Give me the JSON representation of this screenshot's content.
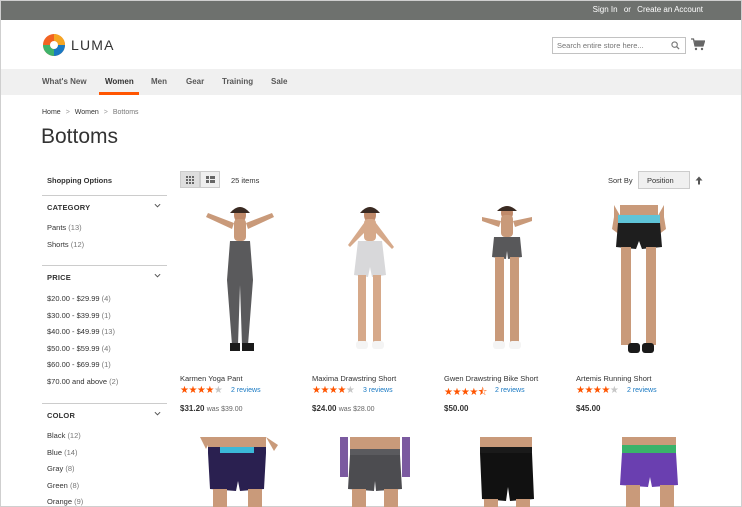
{
  "topbar": {
    "sign_in": "Sign In",
    "or": "or",
    "create_account": "Create an Account"
  },
  "header": {
    "logo_text": "LUMA",
    "search_placeholder": "Search entire store here..."
  },
  "nav": {
    "items": [
      "What's New",
      "Women",
      "Men",
      "Gear",
      "Training",
      "Sale"
    ],
    "active": "Women"
  },
  "breadcrumb": [
    "Home",
    "Women",
    "Bottoms"
  ],
  "page_title": "Bottoms",
  "sidebar": {
    "shopping_options": "Shopping Options",
    "category": {
      "title": "CATEGORY",
      "options": [
        {
          "label": "Pants",
          "count": "(13)"
        },
        {
          "label": "Shorts",
          "count": "(12)"
        }
      ]
    },
    "price": {
      "title": "PRICE",
      "options": [
        {
          "label": "$20.00 - $29.99",
          "count": "(4)"
        },
        {
          "label": "$30.00 - $39.99",
          "count": "(1)"
        },
        {
          "label": "$40.00 - $49.99",
          "count": "(13)"
        },
        {
          "label": "$50.00 - $59.99",
          "count": "(4)"
        },
        {
          "label": "$60.00 - $69.99",
          "count": "(1)"
        },
        {
          "label": "$70.00 and above",
          "count": "(2)"
        }
      ]
    },
    "color": {
      "title": "COLOR",
      "options": [
        {
          "label": "Black",
          "count": "(12)"
        },
        {
          "label": "Blue",
          "count": "(14)"
        },
        {
          "label": "Gray",
          "count": "(8)"
        },
        {
          "label": "Green",
          "count": "(8)"
        },
        {
          "label": "Orange",
          "count": "(9)"
        }
      ]
    }
  },
  "toolbar": {
    "items_count": "25 items",
    "sort_by_label": "Sort By",
    "sort_value": "Position"
  },
  "products": [
    {
      "name": "Karmen Yoga Pant",
      "rating": 4,
      "reviews": "2 reviews",
      "price": "$31.20",
      "was": "was $39.00",
      "top_color": "#6b6a6b",
      "bottom_color": "#4a4a4a",
      "type": "pants"
    },
    {
      "name": "Maxima Drawstring Short",
      "rating": 4,
      "reviews": "3 reviews",
      "price": "$24.00",
      "was": "was $28.00",
      "top_color": "#d8d8da",
      "bottom_color": "#c9c9cc",
      "type": "shorts"
    },
    {
      "name": "Gwen Drawstring Bike Short",
      "rating": 4.5,
      "reviews": "2 reviews",
      "price": "$50.00",
      "was": "",
      "top_color": "#58585a",
      "bottom_color": "#47474a",
      "type": "shorts"
    },
    {
      "name": "Artemis Running Short",
      "rating": 4,
      "reviews": "2 reviews",
      "price": "$45.00",
      "was": "",
      "top_color": "#5fc4d8",
      "bottom_color": "#1e1e1e",
      "type": "shorts"
    }
  ],
  "products_row2": [
    {
      "top_color": "#3bb8d8",
      "bottom_color": "#2a2050"
    },
    {
      "top_color": "#7b5aa0",
      "bottom_color": "#4c4c50"
    },
    {
      "top_color": "#1a1a1a",
      "bottom_color": "#111111"
    },
    {
      "top_color": "#39b36a",
      "bottom_color": "#6a3fb0"
    }
  ],
  "colors": {
    "accent": "#ff5501",
    "link": "#1979c3",
    "topbar": "#6e716e"
  }
}
